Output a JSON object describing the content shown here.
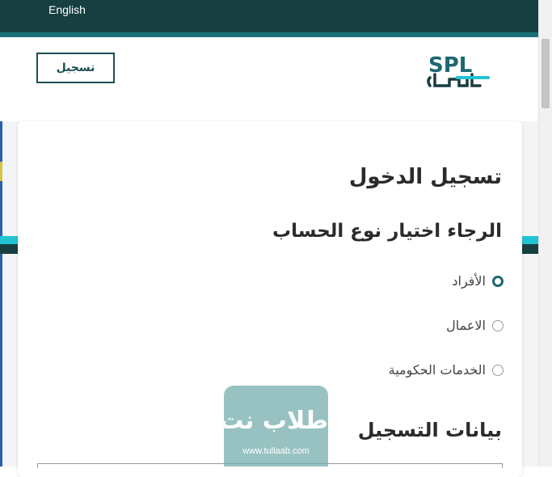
{
  "topbar": {
    "language_link": "English"
  },
  "header": {
    "register_button": "تسجيل",
    "logo_text": "SPL"
  },
  "login": {
    "title": "تسجيل الدخول",
    "account_type_prompt": "الرجاء اختيار نوع الحساب",
    "account_types": [
      {
        "label": "الأفراد",
        "selected": true
      },
      {
        "label": "الاعمال",
        "selected": false
      },
      {
        "label": "الخدمات الحكومية",
        "selected": false
      }
    ],
    "registration_data_title": "بيانات التسجيل"
  },
  "watermark": {
    "name": "طلاب نت",
    "url": "www.tullaab.com"
  },
  "colors": {
    "topbar": "#173f42",
    "accent_cyan": "#21c3d2",
    "brand_teal": "#1d6672"
  }
}
